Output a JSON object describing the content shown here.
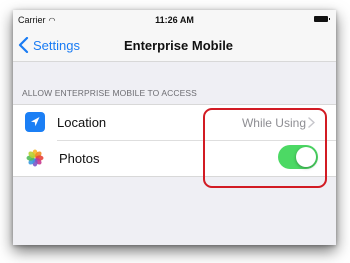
{
  "status_bar": {
    "carrier": "Carrier",
    "time": "11:26 AM",
    "wifi_icon": "wifi-icon",
    "battery_icon": "battery-icon"
  },
  "nav": {
    "back_label": "Settings",
    "title": "Enterprise Mobile"
  },
  "section": {
    "header": "ALLOW ENTERPRISE MOBILE TO ACCESS",
    "rows": [
      {
        "label": "Location",
        "icon": "location-arrow-icon",
        "value": "While Using",
        "accessory": "chevron-right-icon"
      },
      {
        "label": "Photos",
        "icon": "photos-flower-icon",
        "toggle_on": true
      }
    ]
  },
  "colors": {
    "accent": "#1a7cf4",
    "toggle_on": "#4cd964",
    "highlight": "#d21b23"
  }
}
